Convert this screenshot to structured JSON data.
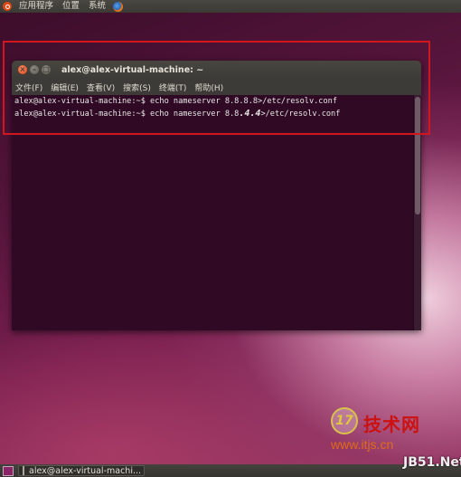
{
  "top_panel": {
    "menus": [
      "应用程序",
      "位置",
      "系统"
    ],
    "icons": [
      "ubuntu-logo-icon",
      "firefox-icon"
    ]
  },
  "terminal": {
    "title": "alex@alex-virtual-machine: ~",
    "menu": [
      "文件(F)",
      "编辑(E)",
      "查看(V)",
      "搜索(S)",
      "终端(T)",
      "帮助(H)"
    ],
    "lines": {
      "line1": "alex@alex-virtual-machine:~$ echo nameserver 8.8.8.8>/etc/resolv.conf",
      "line2_prefix": "alex@alex-virtual-machine:~$ echo nameserver 8.8",
      "line2_emph": ".4.4",
      "line2_suffix": ">/etc/resolv.conf"
    },
    "colors": {
      "background": "#300a24",
      "text": "#e6e6e6"
    }
  },
  "annotation": {
    "color": "#d0171c"
  },
  "watermark": {
    "logo_number": "17",
    "title": "技术网",
    "url": "www.itjs.cn",
    "site": "JB51.Net"
  },
  "taskbar": {
    "task_label": "alex@alex-virtual-machi..."
  }
}
